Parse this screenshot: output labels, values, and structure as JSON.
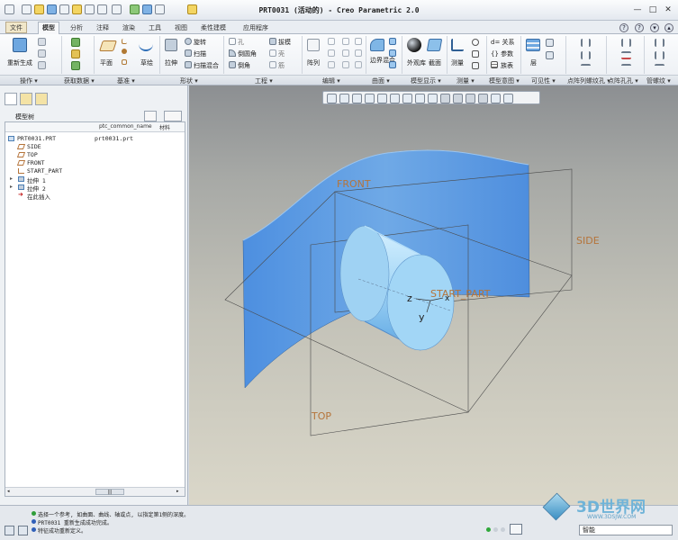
{
  "window": {
    "title": "PRT0031 (活动的) - Creo Parametric 2.0",
    "minimize": "—",
    "maximize": "□",
    "close": "✕"
  },
  "tabs": [
    {
      "label": "文件"
    },
    {
      "label": "模型"
    },
    {
      "label": "分析"
    },
    {
      "label": "注释"
    },
    {
      "label": "渲染"
    },
    {
      "label": "工具"
    },
    {
      "label": "视图"
    },
    {
      "label": "柔性建模"
    },
    {
      "label": "应用程序"
    }
  ],
  "ribbon": {
    "regenerate": "重新生成",
    "plane": "平面",
    "sketch": "草绘",
    "extrude": "拉伸",
    "revolve": "旋转",
    "sweep": "扫描",
    "swept_blend": "扫描混合",
    "hole": "孔",
    "round": "倒圆角",
    "chamfer": "倒角",
    "draft": "拔模",
    "shell": "壳",
    "rib": "筋",
    "pattern": "阵列",
    "boundary_blend": "边界混合",
    "appearance": "外观库",
    "section": "截面",
    "measure": "测量",
    "relations": "d= 关系",
    "parameters": "{} 参数",
    "family_table": "族表",
    "layer": "层"
  },
  "groups": [
    "操作 ▾",
    "获取数据 ▾",
    "基准 ▾",
    "形状 ▾",
    "工程 ▾",
    "编辑 ▾",
    "曲面 ▾",
    "模型显示 ▾",
    "测量 ▾",
    "模型意图 ▾",
    "可见性 ▾",
    "点阵列螺纹孔 ▾",
    "点阵孔孔 ▾",
    "管螺纹 ▾"
  ],
  "sidebar": {
    "title": "模型树",
    "columns": [
      "ptc_common_name",
      "材料"
    ],
    "items": [
      {
        "label": "PRT0031.PRT",
        "common_name": "prt0031.prt"
      },
      {
        "label": "SIDE"
      },
      {
        "label": "TOP"
      },
      {
        "label": "FRONT"
      },
      {
        "label": "START_PART"
      },
      {
        "label": "拉伸 1"
      },
      {
        "label": "拉伸 2"
      },
      {
        "label": "在此插入"
      }
    ],
    "scroll_mark": "|||"
  },
  "viewport": {
    "labels": {
      "front": "FRONT",
      "side": "SIDE",
      "top": "TOP",
      "start_part": "START_PART",
      "z": "z",
      "x": "x",
      "y": "y"
    }
  },
  "status": {
    "messages": [
      "选择一个参考, 如曲面、曲线、轴或点, 以指定第1侧的深度。",
      "PRT0031 重新生成成功完成。",
      "特征成功重新定义。"
    ],
    "filter": "智能",
    "watermark": {
      "title": "3D世界网",
      "url": "WWW.3DSJW.COM"
    }
  },
  "colors": {
    "surface": "#5c98de",
    "cylinder": "#a9d9f7",
    "datum": "#b5743a"
  }
}
